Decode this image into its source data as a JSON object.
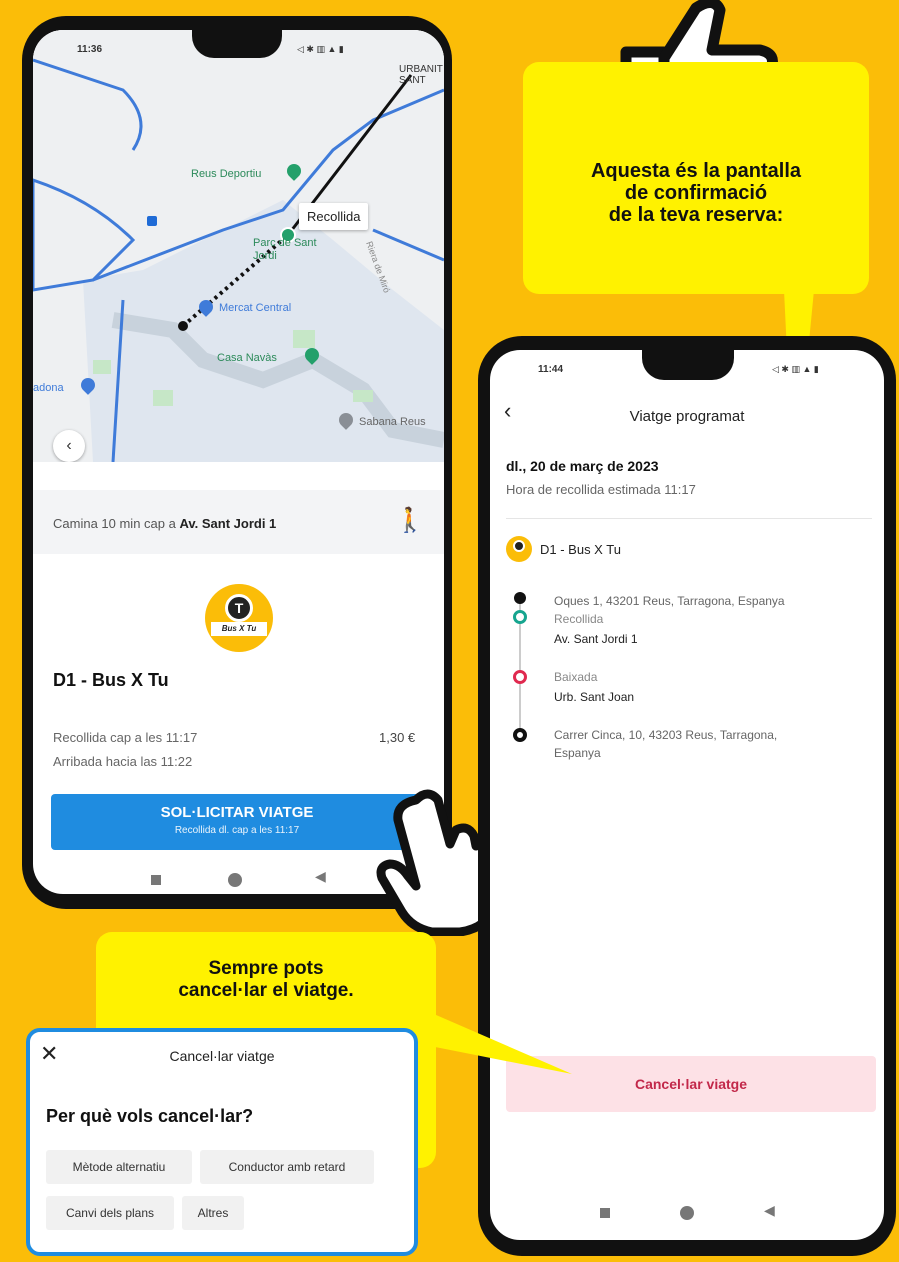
{
  "colors": {
    "background": "#fbbd08",
    "callout": "#fff200",
    "primary_button": "#1f8ce0",
    "cancel_button_bg": "#fde1e6",
    "cancel_text": "#c2284a",
    "accent_teal": "#16a58f",
    "accent_red": "#e0294f"
  },
  "left_phone": {
    "status_time": "11:36",
    "map": {
      "labels": [
        "Reus Deportiu",
        "Recollida",
        "Parc de Sant Jordi",
        "Mercat Central",
        "Casa Navàs",
        "Sabana Reus",
        "adona",
        "Riera de Miró",
        "URBANIT SANT"
      ],
      "back_icon": "chevron-left-icon"
    },
    "walk_prefix": "Camina 10 min cap a",
    "walk_dest": "Av. Sant Jordi 1",
    "walk_icon": "walking-person-icon",
    "service_logo_text": "Bus X Tu",
    "service_name": "D1 - Bus X Tu",
    "pickup_text": "Recollida cap a les 11:17",
    "arrival_text": "Arribada hacia las 11:22",
    "price": "1,30 €",
    "request_button": {
      "label": "SOL·LICITAR VIATGE",
      "sublabel": "Recollida dl. cap a les 11:17"
    }
  },
  "right_phone": {
    "status_time": "11:44",
    "header_title": "Viatge programat",
    "date": "dl., 20 de març de 2023",
    "pickup_estimate": "Hora de recollida estimada 11:17",
    "service_name": "D1 - Bus X Tu",
    "timeline": {
      "origin": "Oques 1, 43201 Reus, Tarragona, Espanya",
      "pickup_label": "Recollida",
      "pickup_stop": "Av. Sant Jordi 1",
      "dropoff_label": "Baixada",
      "dropoff_stop": "Urb. Sant Joan",
      "destination_line1": "Carrer Cinca, 10, 43203 Reus, Tarragona,",
      "destination_line2": "Espanya"
    },
    "cancel_button": "Cancel·lar viatge"
  },
  "callouts": {
    "confirm_line1": "Aquesta és la pantalla",
    "confirm_line2": "de confirmació",
    "confirm_line3": "de la teva reserva:",
    "cancel_line1": "Sempre pots",
    "cancel_line2": "cancel·lar el viatge."
  },
  "cancel_sheet": {
    "title": "Cancel·lar viatge",
    "question": "Per què vols cancel·lar?",
    "reasons": [
      "Mètode alternatiu",
      "Conductor amb retard",
      "Canvi dels plans",
      "Altres"
    ]
  }
}
